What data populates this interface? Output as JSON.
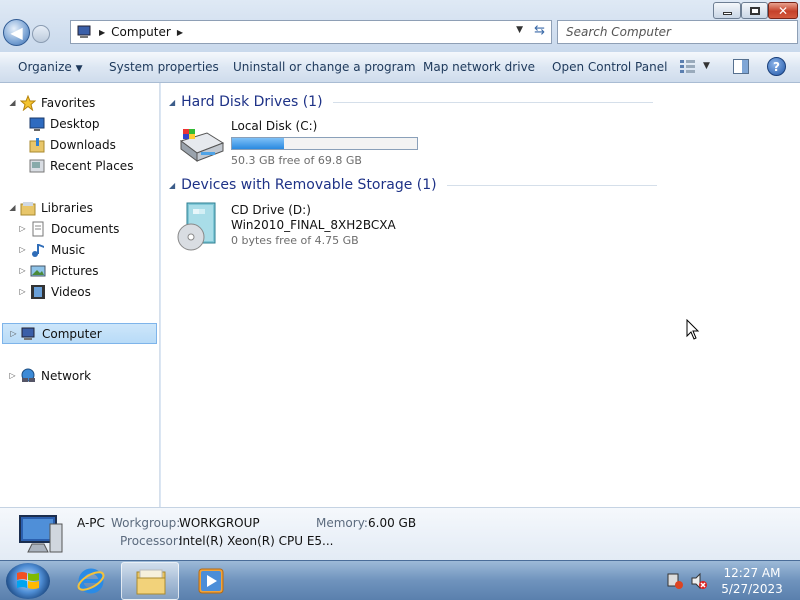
{
  "address": {
    "location": "Computer"
  },
  "search": {
    "placeholder": "Search Computer"
  },
  "toolbar": {
    "organize": "Organize",
    "system_properties": "System properties",
    "uninstall": "Uninstall or change a program",
    "map_drive": "Map network drive",
    "control_panel": "Open Control Panel"
  },
  "nav": {
    "favorites": "Favorites",
    "desktop": "Desktop",
    "downloads": "Downloads",
    "recent_places": "Recent Places",
    "libraries": "Libraries",
    "documents": "Documents",
    "music": "Music",
    "pictures": "Pictures",
    "videos": "Videos",
    "computer": "Computer",
    "network": "Network"
  },
  "groups": {
    "hard_disk": "Hard Disk Drives (1)",
    "removable": "Devices with Removable Storage (1)"
  },
  "drives": {
    "local": {
      "name": "Local Disk (C:)",
      "free": "50.3 GB free of 69.8 GB",
      "used_fraction": 0.28
    },
    "cd": {
      "name": "CD Drive (D:)",
      "label": "Win2010_FINAL_8XH2BCXA",
      "free": "0 bytes free of 4.75 GB"
    }
  },
  "details": {
    "pc_name": "A-PC",
    "workgroup_label": "Workgroup:",
    "workgroup": "WORKGROUP",
    "memory_label": "Memory:",
    "memory": "6.00 GB",
    "processor_label": "Processor:",
    "processor": "Intel(R) Xeon(R) CPU E5..."
  },
  "clock": {
    "time": "12:27 AM",
    "date": "5/27/2023"
  }
}
